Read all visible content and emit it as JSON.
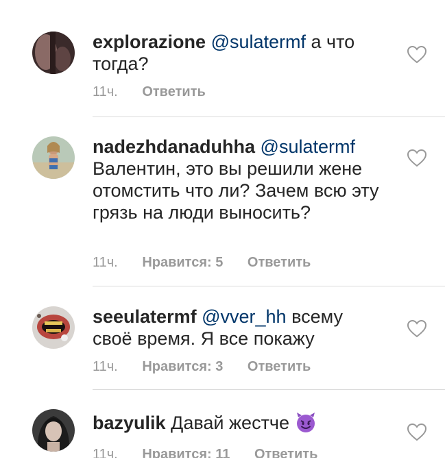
{
  "comments": [
    {
      "username": "explorazione",
      "mention": "@sulatermf",
      "text": " а что тогда?",
      "time": "11ч.",
      "likes": "",
      "reply": "Ответить"
    },
    {
      "username": "nadezhdanaduhha",
      "mention": "@sulatermf",
      "text": " Валентин, это вы решили жене отомстить что ли? Зачем всю эту грязь на люди выносить?",
      "time": "11ч.",
      "likes": "Нравится: 5",
      "reply": "Ответить"
    },
    {
      "username": "seeulatermf",
      "mention": "@vver_hh",
      "text": " всему своё время. Я все покажу",
      "time": "11ч.",
      "likes": "Нравится: 3",
      "reply": "Ответить"
    },
    {
      "username": "bazyulik",
      "mention": "",
      "text": " Давай жестче",
      "emoji": "smiling-imp-emoji",
      "time": "11ч.",
      "likes": "Нравится: 11",
      "reply": "Ответить"
    }
  ],
  "icons": {
    "like": "heart-outline-icon"
  },
  "colors": {
    "text": "#262626",
    "mention": "#003569",
    "meta": "#999999",
    "divider": "#dbdbdb"
  }
}
